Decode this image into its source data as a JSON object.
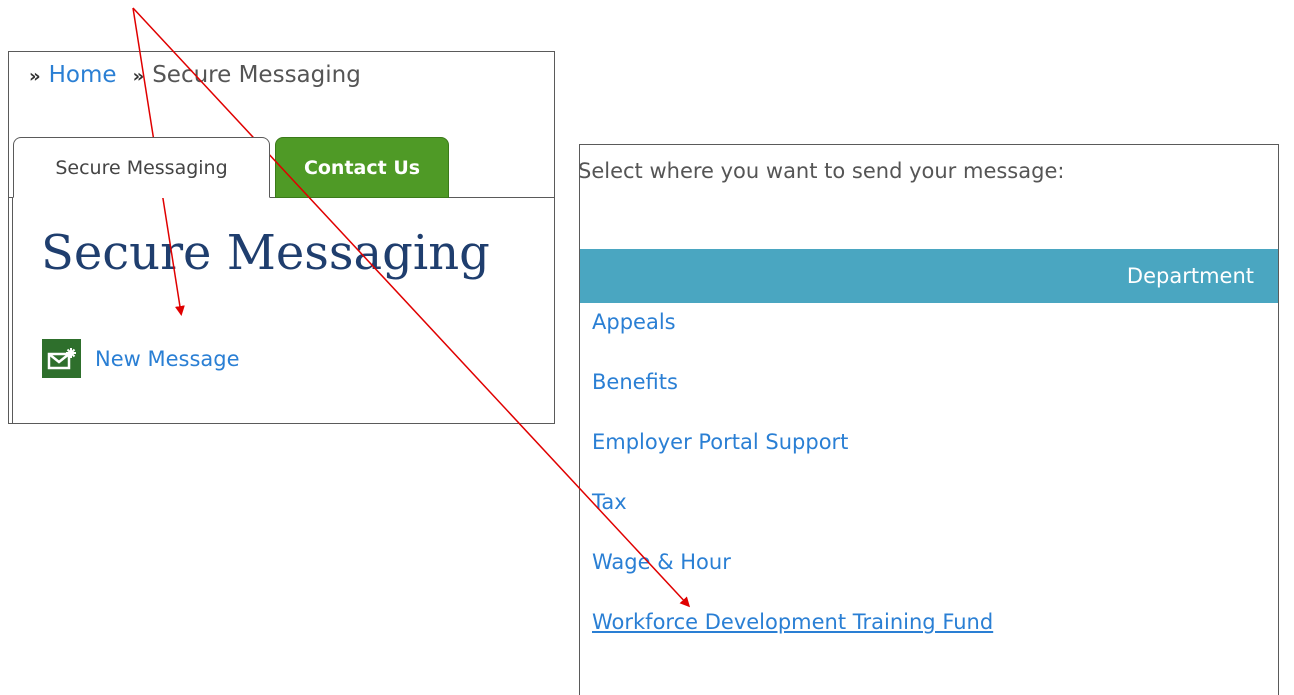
{
  "breadcrumb": {
    "separator": "»",
    "home": "Home",
    "current": "Secure Messaging"
  },
  "tabs": [
    {
      "label": "Secure Messaging"
    },
    {
      "label": "Contact Us"
    }
  ],
  "page_title": "Secure Messaging",
  "new_message_label": "New Message",
  "select_prompt": "Select where you want to send your message:",
  "table_header": "Department",
  "departments": [
    "Appeals",
    "Benefits",
    "Employer Portal Support",
    "Tax",
    "Wage & Hour",
    "Workforce Development Training Fund"
  ],
  "colors": {
    "link": "#2a7fd4",
    "title": "#1f3e6e",
    "tab_active_bg": "#4f9a26",
    "table_header_bg": "#4aa6c1",
    "arrow": "#e00000",
    "icon_bg": "#2e6f2c"
  },
  "icons": {
    "new_message": "mail-new-icon"
  }
}
